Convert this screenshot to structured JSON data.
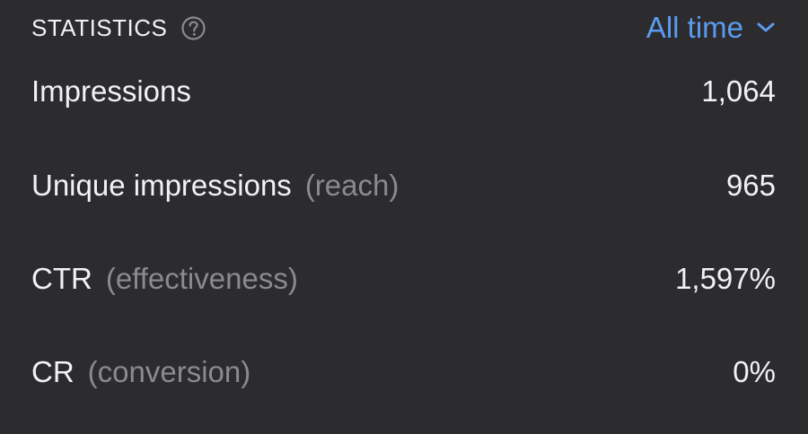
{
  "header": {
    "title": "STATISTICS",
    "help_icon": "question-circle-icon",
    "period_label": "All time",
    "period_icon": "chevron-down-icon"
  },
  "stats": [
    {
      "label": "Impressions",
      "hint": "",
      "value": "1,064"
    },
    {
      "label": "Unique impressions",
      "hint": "(reach)",
      "value": "965"
    },
    {
      "label": "CTR",
      "hint": "(effectiveness)",
      "value": "1,597%"
    },
    {
      "label": "CR",
      "hint": "(conversion)",
      "value": "0%"
    }
  ],
  "colors": {
    "background": "#2c2c2e",
    "text": "#f2f2f4",
    "muted": "#8a8a8f",
    "accent": "#5b9bf0"
  }
}
